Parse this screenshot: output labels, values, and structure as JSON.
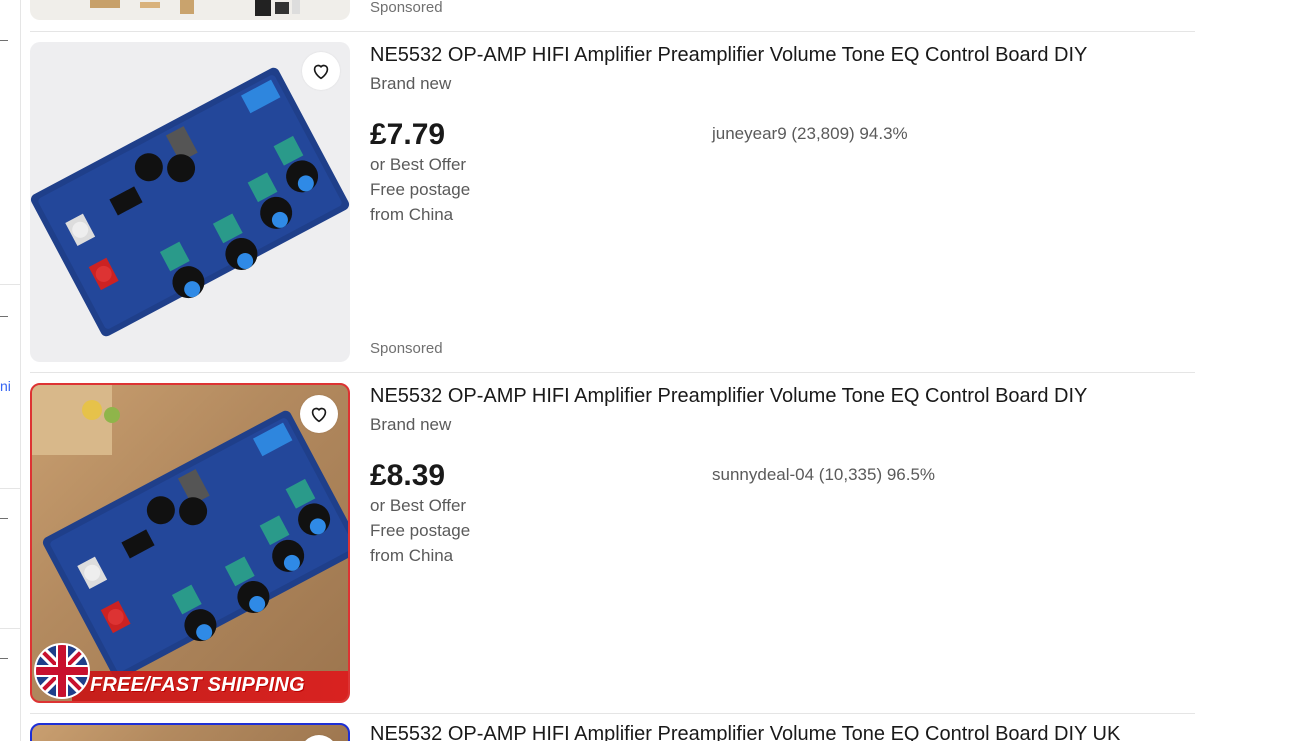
{
  "top_partial": {
    "sponsored": "Sponsored"
  },
  "listings": [
    {
      "title": "NE5532 OP-AMP HIFI Amplifier Preamplifier Volume Tone EQ Control Board DIY",
      "condition": "Brand new",
      "price": "£7.79",
      "offer": "or Best Offer",
      "postage": "Free postage",
      "origin": "from China",
      "seller": "juneyear9 (23,809) 94.3%",
      "sponsored": "Sponsored",
      "favorite_icon": "heart-icon"
    },
    {
      "title": "NE5532 OP-AMP HIFI Amplifier Preamplifier Volume Tone EQ Control Board DIY",
      "condition": "Brand new",
      "price": "£8.39",
      "offer": "or Best Offer",
      "postage": "Free postage",
      "origin": "from China",
      "seller": "sunnydeal-04 (10,335) 96.5%",
      "image_banner": "FREE/FAST SHIPPING",
      "favorite_icon": "heart-icon"
    },
    {
      "title": "NE5532 OP-AMP HIFI Amplifier Preamplifier Volume Tone EQ Control Board DIY UK",
      "favorite_icon": "heart-icon"
    }
  ],
  "left_rail": {
    "partial_text": "ni"
  },
  "colors": {
    "link": "#3665f3",
    "text_primary": "#191919",
    "text_secondary": "#5a5a5a",
    "divider": "#e5e5e5"
  }
}
